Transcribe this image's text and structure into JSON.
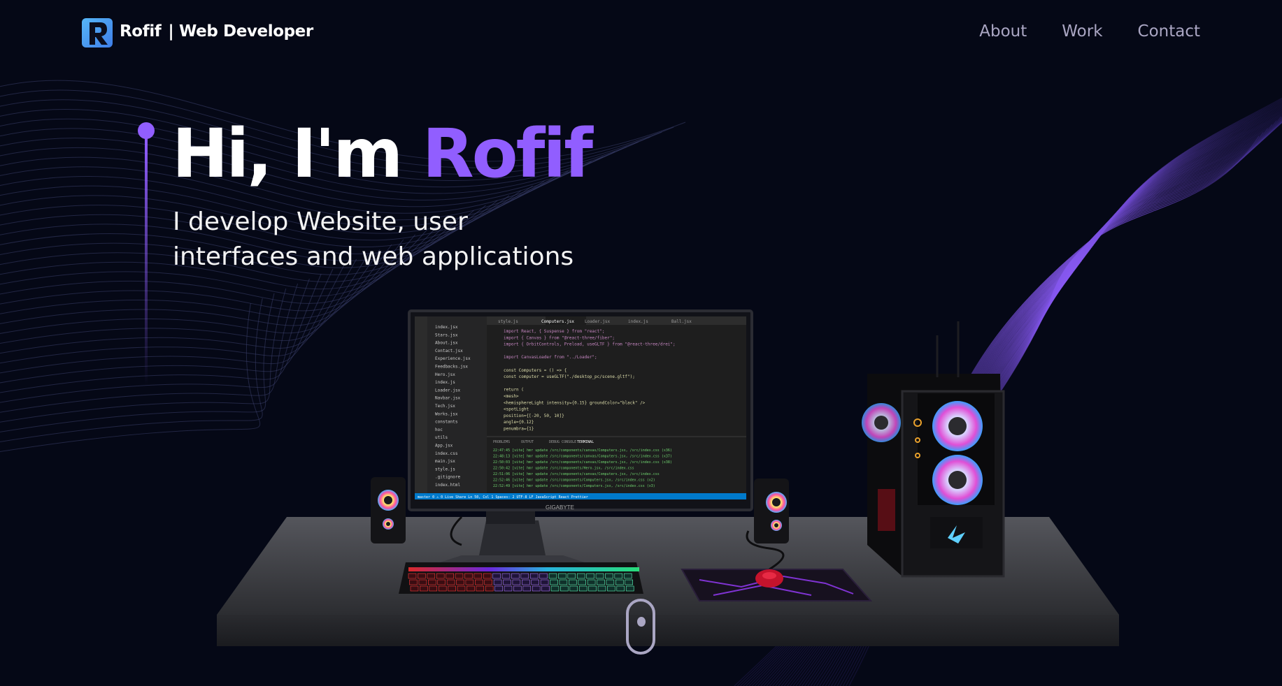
{
  "nav": {
    "brand_name": "Rofif",
    "brand_role": "| Web Developer",
    "logo_letter": "R",
    "links": [
      "About",
      "Work",
      "Contact"
    ]
  },
  "hero": {
    "title_prefix": "Hi, I'm",
    "title_name": "Rofif",
    "subtitle_line1": "I develop Website, user",
    "subtitle_line2": "interfaces and web applications"
  },
  "monitor": {
    "brand": "GIGABYTE",
    "tabs": [
      "style.js",
      "Computers.jsx",
      "Loader.jsx",
      "index.js",
      "Ball.jsx"
    ],
    "explorer_items": [
      "index.jsx",
      "Stars.jsx",
      "About.jsx",
      "Contact.jsx",
      "Experience.jsx",
      "Feedbacks.jsx",
      "Hero.jsx",
      "index.js",
      "Loader.jsx",
      "Navbar.jsx",
      "Tech.jsx",
      "Works.jsx",
      "constants",
      "hoc",
      "utils",
      "App.jsx",
      "index.css",
      "main.jsx",
      "style.js",
      ".gitignore",
      "index.html"
    ],
    "code_lines": [
      "import React, { Suspense } from \"react\";",
      "import { Canvas } from \"@react-three/fiber\";",
      "import { OrbitControls, Preload, useGLTF } from \"@react-three/drei\";",
      "",
      "import CanvasLoader from \"../Loader\";",
      "",
      "const Computers = () => {",
      "  const computer = useGLTF(\"./desktop_pc/scene.gltf\");",
      "",
      "  return (",
      "    <mesh>",
      "      <hemisphereLight intensity={0.15} groundColor=\"black\" />",
      "      <spotLight",
      "        position={[-20, 50, 10]}",
      "        angle={0.12}",
      "        penumbra={1}"
    ],
    "terminal_tabs": [
      "PROBLEMS",
      "OUTPUT",
      "DEBUG CONSOLE",
      "TERMINAL"
    ],
    "terminal_lines": [
      "22:47:45 [vite] hmr update /src/components/canvas/Computers.jsx, /src/index.css (x36)",
      "22:48:13 [vite] hmr update /src/components/canvas/Computers.jsx, /src/index.css (x37)",
      "22:50:03 [vite] hmr update /src/components/canvas/Computers.jsx, /src/index.css (x38)",
      "22:50:42 [vite] hmr update /src/components/Hero.jsx, /src/index.css",
      "22:51:06 [vite] hmr update /src/components/canvas/Computers.jsx, /src/index.css",
      "22:52:46 [vite] hmr update /src/components/Computers.jsx, /src/index.css (x2)",
      "22:52:49 [vite] hmr update /src/components/Computers.jsx, /src/index.css (x3)"
    ],
    "status_bar": "master   0 ⚠ 0   Live Share        Ln 50, Col 1   Spaces: 2   UTF-8   LF   JavaScript React   Prettier"
  },
  "colors": {
    "background": "#050816",
    "accent": "#915eff",
    "nav_link": "#aaa6c3",
    "wave": "#7b4ff5"
  },
  "icons": [
    "logo-r-icon",
    "scroll-mouse-icon"
  ]
}
